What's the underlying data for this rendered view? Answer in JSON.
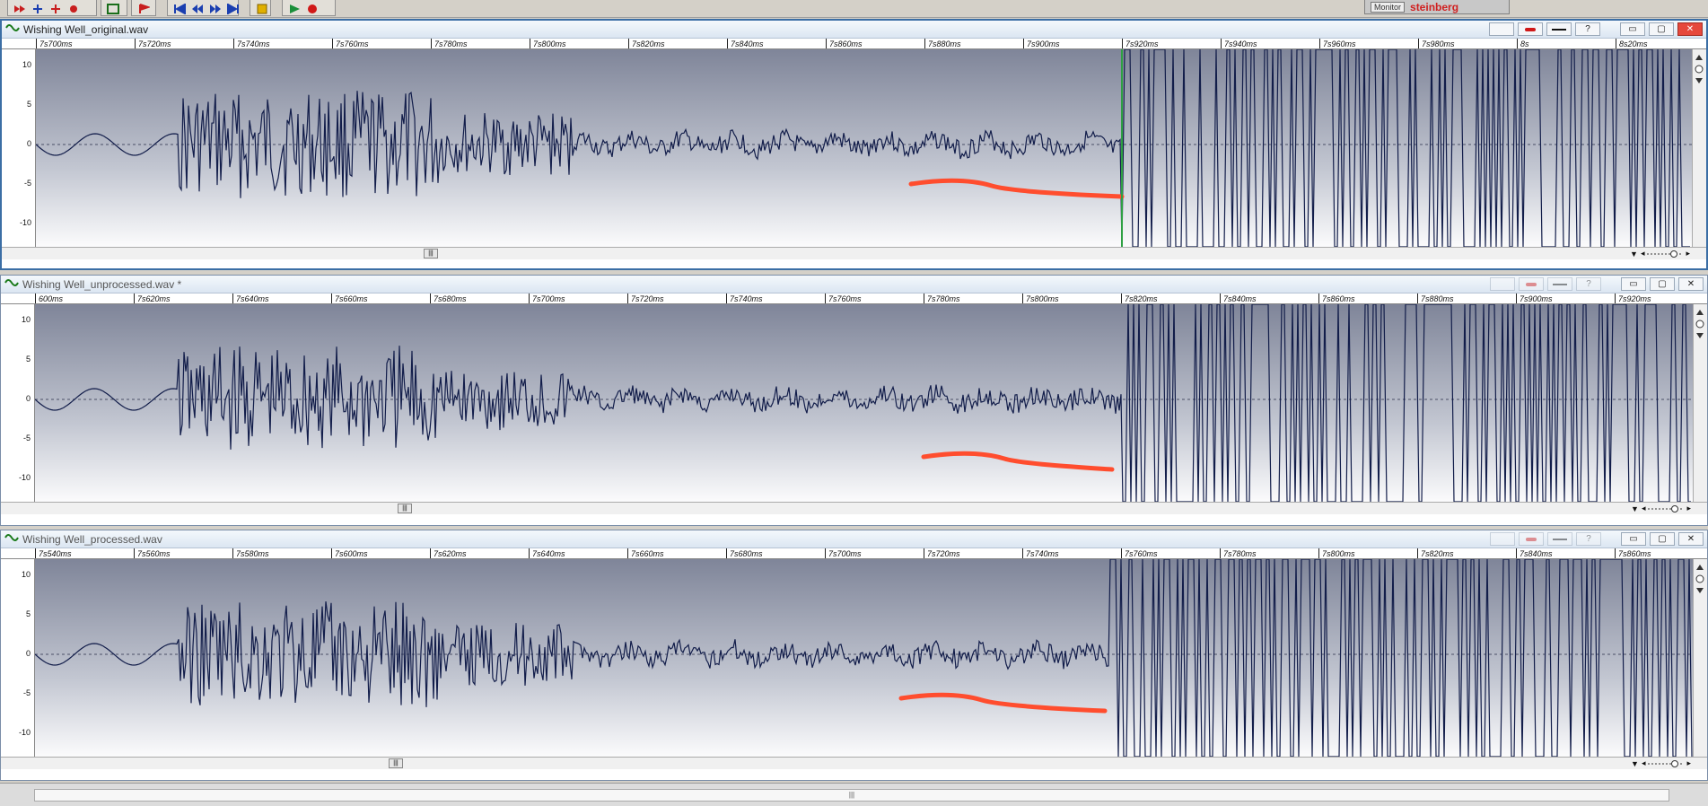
{
  "brand": {
    "monitor_label": "Monitor",
    "logo_text": "steinberg"
  },
  "windows": [
    {
      "title": "Wishing Well_original.wav",
      "active": true,
      "ticks": [
        "7s700ms",
        "7s720ms",
        "7s740ms",
        "7s760ms",
        "7s780ms",
        "7s800ms",
        "7s820ms",
        "7s840ms",
        "7s860ms",
        "7s880ms",
        "7s900ms",
        "7s920ms",
        "7s940ms",
        "7s960ms",
        "7s980ms",
        "8s",
        "8s20ms"
      ],
      "ylabels": [
        "10",
        "5",
        "0",
        "-5",
        "-10"
      ]
    },
    {
      "title": "Wishing Well_unprocessed.wav *",
      "active": false,
      "ticks": [
        "600ms",
        "7s620ms",
        "7s640ms",
        "7s660ms",
        "7s680ms",
        "7s700ms",
        "7s720ms",
        "7s740ms",
        "7s760ms",
        "7s780ms",
        "7s800ms",
        "7s820ms",
        "7s840ms",
        "7s860ms",
        "7s880ms",
        "7s900ms",
        "7s920ms"
      ],
      "ylabels": [
        "10",
        "5",
        "0",
        "-5",
        "-10"
      ]
    },
    {
      "title": "Wishing Well_processed.wav",
      "active": false,
      "ticks": [
        "7s540ms",
        "7s560ms",
        "7s580ms",
        "7s600ms",
        "7s620ms",
        "7s640ms",
        "7s660ms",
        "7s680ms",
        "7s700ms",
        "7s720ms",
        "7s740ms",
        "7s760ms",
        "7s780ms",
        "7s800ms",
        "7s820ms",
        "7s840ms",
        "7s860ms"
      ],
      "ylabels": [
        "10",
        "5",
        "0",
        "-5",
        "-10"
      ]
    }
  ],
  "icons": {
    "wave": "wave-icon",
    "help": "?"
  },
  "colors": {
    "waveform": "#121d4a",
    "annotation": "#ff4d2e",
    "active_border": "#3b6ea5"
  }
}
